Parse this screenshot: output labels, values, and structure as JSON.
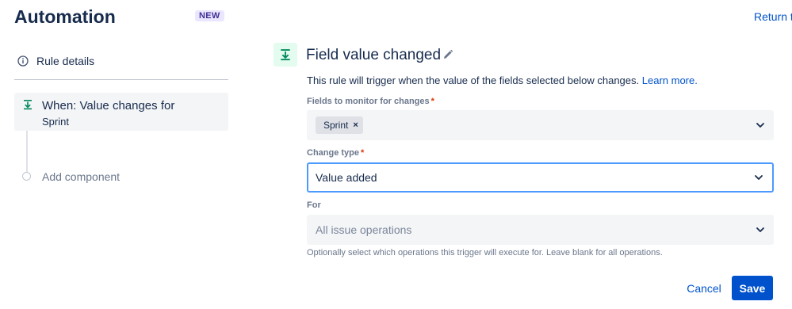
{
  "header": {
    "title": "Automation",
    "badge": "NEW",
    "return_link": "Return t"
  },
  "sidebar": {
    "rule_details": {
      "label": "Rule details",
      "icon": "info-icon"
    },
    "trigger_item": {
      "title": "When: Value changes for",
      "subtitle": "Sprint",
      "icon": "field-trigger-icon"
    },
    "add_component": {
      "label": "Add component"
    }
  },
  "main": {
    "title": "Field value changed",
    "description_prefix": "This rule will trigger when the value of the fields selected below changes.",
    "learn_more": "Learn more.",
    "fields": {
      "label": "Fields to monitor for changes",
      "required_mark": "*",
      "selected": [
        "Sprint"
      ],
      "remove_glyph": "×"
    },
    "change_type": {
      "label": "Change type",
      "required_mark": "*",
      "value": "Value added"
    },
    "for": {
      "label": "For",
      "placeholder": "All issue operations",
      "help": "Optionally select which operations this trigger will execute for. Leave blank for all operations."
    },
    "actions": {
      "cancel": "Cancel",
      "save": "Save"
    }
  },
  "colors": {
    "primary": "#0052cc",
    "text": "#172b4d",
    "subtle_text": "#6b778c",
    "focus_border": "#4c9aff",
    "required": "#de350b",
    "trigger_icon_bg": "#e3fcef",
    "trigger_icon": "#00875a"
  }
}
